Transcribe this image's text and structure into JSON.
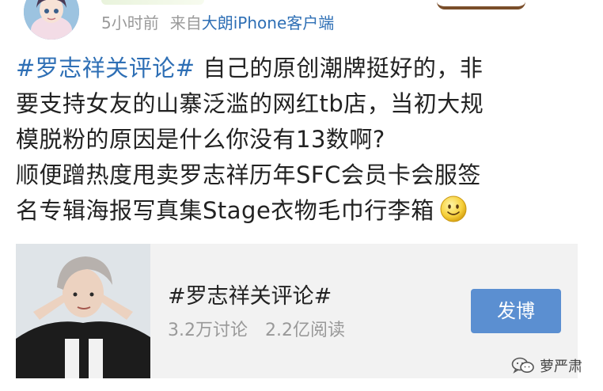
{
  "header": {
    "time_ago": "5小时前",
    "source_prefix": "来自",
    "source_client": "大朗iPhone客户端"
  },
  "post": {
    "hashtag": "#罗志祥关评论#",
    "line1_rest": " 自己的原创潮牌挺好的，非",
    "line2": "要支持女友的山寨泛滥的网红tb店，当初大规",
    "line3": "模脱粉的原因是什么你没有13数啊?",
    "line4": "顺便蹭热度甩卖罗志祥历年SFC会员卡会服签",
    "line5": "名专辑海报写真集Stage衣物毛巾行李箱",
    "emoji_icon": "smiley-emoji"
  },
  "topic_card": {
    "title": "#罗志祥关评论#",
    "discussions": "3.2万讨论",
    "reads": "2.2亿阅读",
    "button_label": "发博"
  },
  "watermark": {
    "text": "萝严肃",
    "icon": "wechat-icon"
  },
  "colors": {
    "link": "#2e6fb5",
    "meta_gray": "#9a9a9a",
    "button_blue": "#5b8fd1",
    "card_bg": "#f2f2f2"
  }
}
